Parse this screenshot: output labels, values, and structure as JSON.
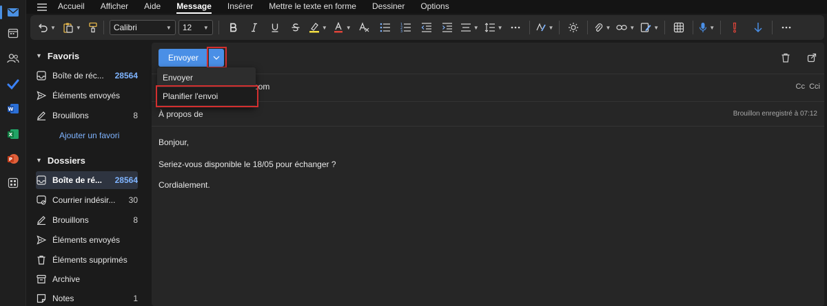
{
  "menu": {
    "tabs": [
      {
        "label": "Accueil"
      },
      {
        "label": "Afficher"
      },
      {
        "label": "Aide"
      },
      {
        "label": "Message"
      },
      {
        "label": "Insérer"
      },
      {
        "label": "Mettre le texte en forme"
      },
      {
        "label": "Dessiner"
      },
      {
        "label": "Options"
      }
    ],
    "active_tab": "Message"
  },
  "ribbon": {
    "font_name": "Calibri",
    "font_size": "12"
  },
  "folders": {
    "favorites_title": "Favoris",
    "favorites": [
      {
        "label": "Boîte de réc...",
        "count": "28564",
        "icon": "inbox-icon"
      },
      {
        "label": "Éléments envoyés",
        "count": "",
        "icon": "send-icon"
      },
      {
        "label": "Brouillons",
        "count": "8",
        "icon": "pencil-icon"
      }
    ],
    "add_favorite": "Ajouter un favori",
    "folders_title": "Dossiers",
    "items": [
      {
        "label": "Boîte de ré...",
        "count": "28564",
        "icon": "inbox-icon"
      },
      {
        "label": "Courrier indésir...",
        "count": "30",
        "icon": "junk-icon"
      },
      {
        "label": "Brouillons",
        "count": "8",
        "icon": "pencil-icon"
      },
      {
        "label": "Éléments envoyés",
        "count": "",
        "icon": "send-icon"
      },
      {
        "label": "Éléments supprimés",
        "count": "",
        "icon": "trash-icon"
      },
      {
        "label": "Archive",
        "count": "",
        "icon": "archive-icon"
      },
      {
        "label": "Notes",
        "count": "1",
        "icon": "note-icon"
      }
    ]
  },
  "compose": {
    "send_label": "Envoyer",
    "to_value": "il.com",
    "cc_label": "Cc",
    "cci_label": "Cci",
    "subject_placeholder": "À propos de",
    "saved_status": "Brouillon enregistré à 07:12",
    "body": [
      "Bonjour,",
      "Seriez-vous disponible le 18/05 pour échanger ?",
      "Cordialement."
    ]
  },
  "dropdown": {
    "items": [
      "Envoyer",
      "Planifier l'envoi"
    ]
  },
  "colors": {
    "accent": "#4a8fe6",
    "highlight": "#d32f2f",
    "link": "#7fb4ff"
  }
}
